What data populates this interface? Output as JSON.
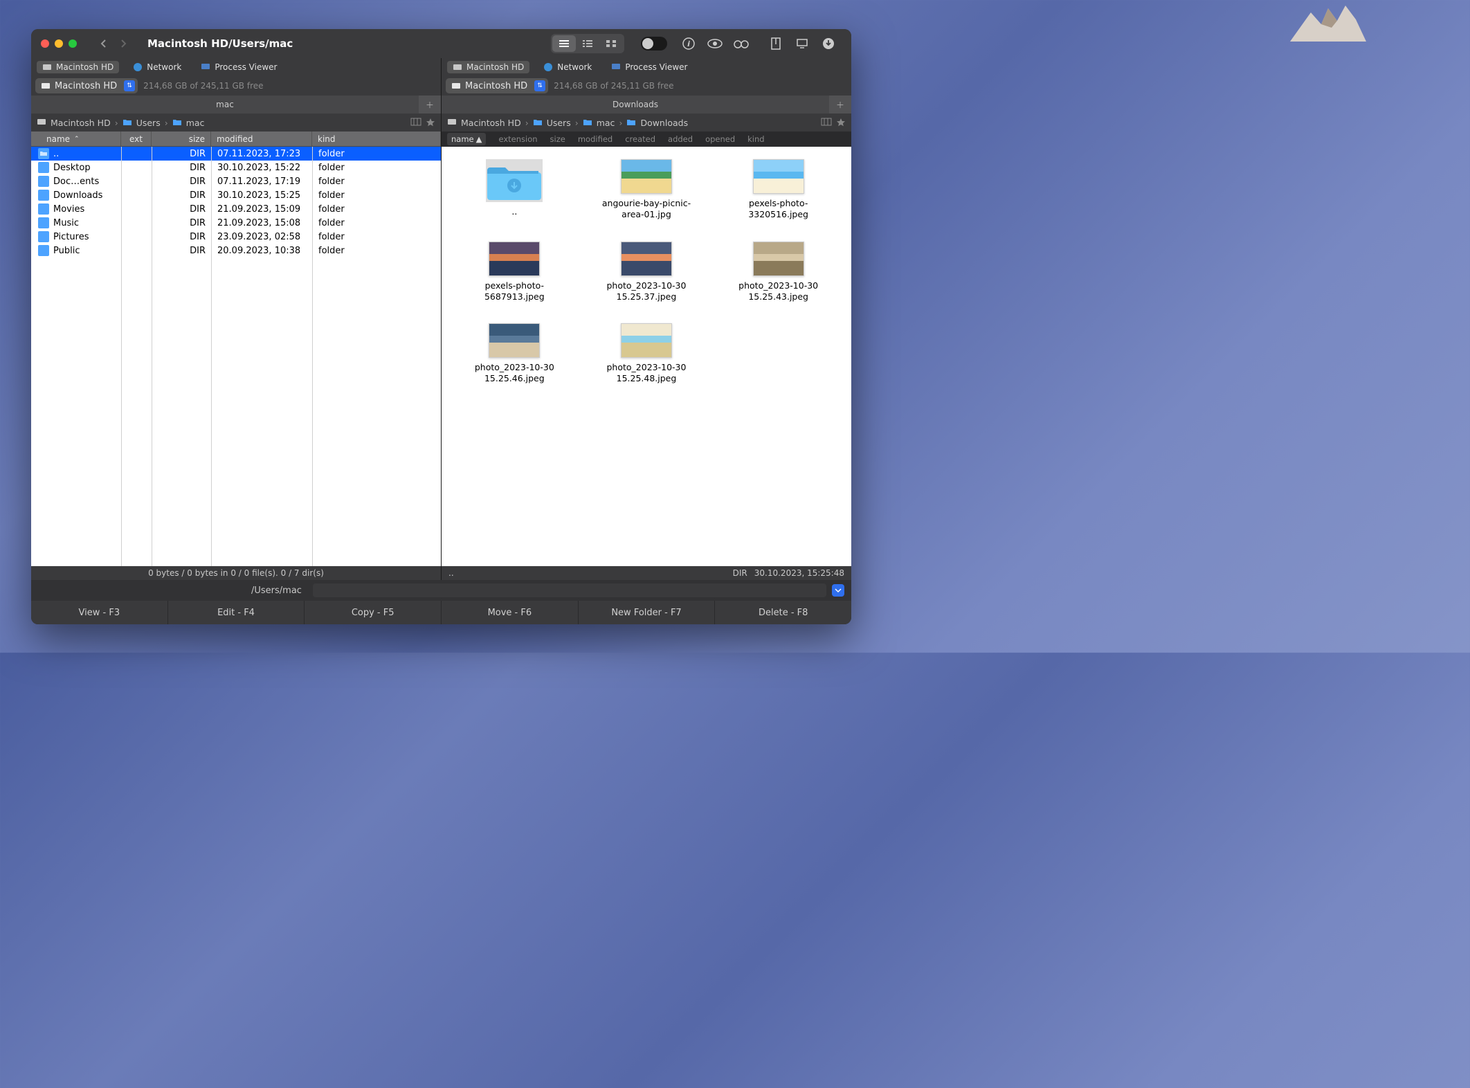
{
  "title": "Macintosh HD/Users/mac",
  "drive_tabs": [
    {
      "label": "Macintosh HD",
      "icon": "hd"
    },
    {
      "label": "Network",
      "icon": "net"
    },
    {
      "label": "Process Viewer",
      "icon": "proc"
    }
  ],
  "drive_select": {
    "label": "Macintosh HD",
    "free": "214,68 GB of 245,11 GB free"
  },
  "left": {
    "tab": "mac",
    "breadcrumbs": [
      {
        "label": "Macintosh HD",
        "icon": "hd"
      },
      {
        "label": "Users",
        "icon": "folder"
      },
      {
        "label": "mac",
        "icon": "folder"
      }
    ],
    "columns": {
      "name": "name",
      "ext": "ext",
      "size": "size",
      "mod": "modified",
      "kind": "kind"
    },
    "rows": [
      {
        "name": "..",
        "size": "DIR",
        "mod": "07.11.2023, 17:23",
        "kind": "folder",
        "sel": true
      },
      {
        "name": "Desktop",
        "size": "DIR",
        "mod": "30.10.2023, 15:22",
        "kind": "folder"
      },
      {
        "name": "Doc…ents",
        "size": "DIR",
        "mod": "07.11.2023, 17:19",
        "kind": "folder"
      },
      {
        "name": "Downloads",
        "size": "DIR",
        "mod": "30.10.2023, 15:25",
        "kind": "folder"
      },
      {
        "name": "Movies",
        "size": "DIR",
        "mod": "21.09.2023, 15:09",
        "kind": "folder"
      },
      {
        "name": "Music",
        "size": "DIR",
        "mod": "21.09.2023, 15:08",
        "kind": "folder"
      },
      {
        "name": "Pictures",
        "size": "DIR",
        "mod": "23.09.2023, 02:58",
        "kind": "folder"
      },
      {
        "name": "Public",
        "size": "DIR",
        "mod": "20.09.2023, 10:38",
        "kind": "folder"
      }
    ],
    "status": "0 bytes / 0 bytes in 0 / 0 file(s). 0 / 7 dir(s)"
  },
  "right": {
    "tab": "Downloads",
    "breadcrumbs": [
      {
        "label": "Macintosh HD",
        "icon": "hd"
      },
      {
        "label": "Users",
        "icon": "folder"
      },
      {
        "label": "mac",
        "icon": "folder"
      },
      {
        "label": "Downloads",
        "icon": "folder"
      }
    ],
    "headers": [
      "name",
      "extension",
      "size",
      "modified",
      "created",
      "added",
      "opened",
      "kind"
    ],
    "items": [
      {
        "name": "..",
        "type": "folder"
      },
      {
        "name": "angourie-bay-picnic-area-01.jpg",
        "type": "image"
      },
      {
        "name": "pexels-photo-3320516.jpeg",
        "type": "image"
      },
      {
        "name": "pexels-photo-5687913.jpeg",
        "type": "image"
      },
      {
        "name": "photo_2023-10-30 15.25.37.jpeg",
        "type": "image"
      },
      {
        "name": "photo_2023-10-30 15.25.43.jpeg",
        "type": "image"
      },
      {
        "name": "photo_2023-10-30 15.25.46.jpeg",
        "type": "image"
      },
      {
        "name": "photo_2023-10-30 15.25.48.jpeg",
        "type": "image"
      }
    ],
    "status": {
      "name": "..",
      "size": "DIR",
      "date": "30.10.2023, 15:25:48"
    }
  },
  "cmd_path": "/Users/mac",
  "fn_buttons": [
    "View - F3",
    "Edit - F4",
    "Copy - F5",
    "Move - F6",
    "New Folder - F7",
    "Delete - F8"
  ]
}
